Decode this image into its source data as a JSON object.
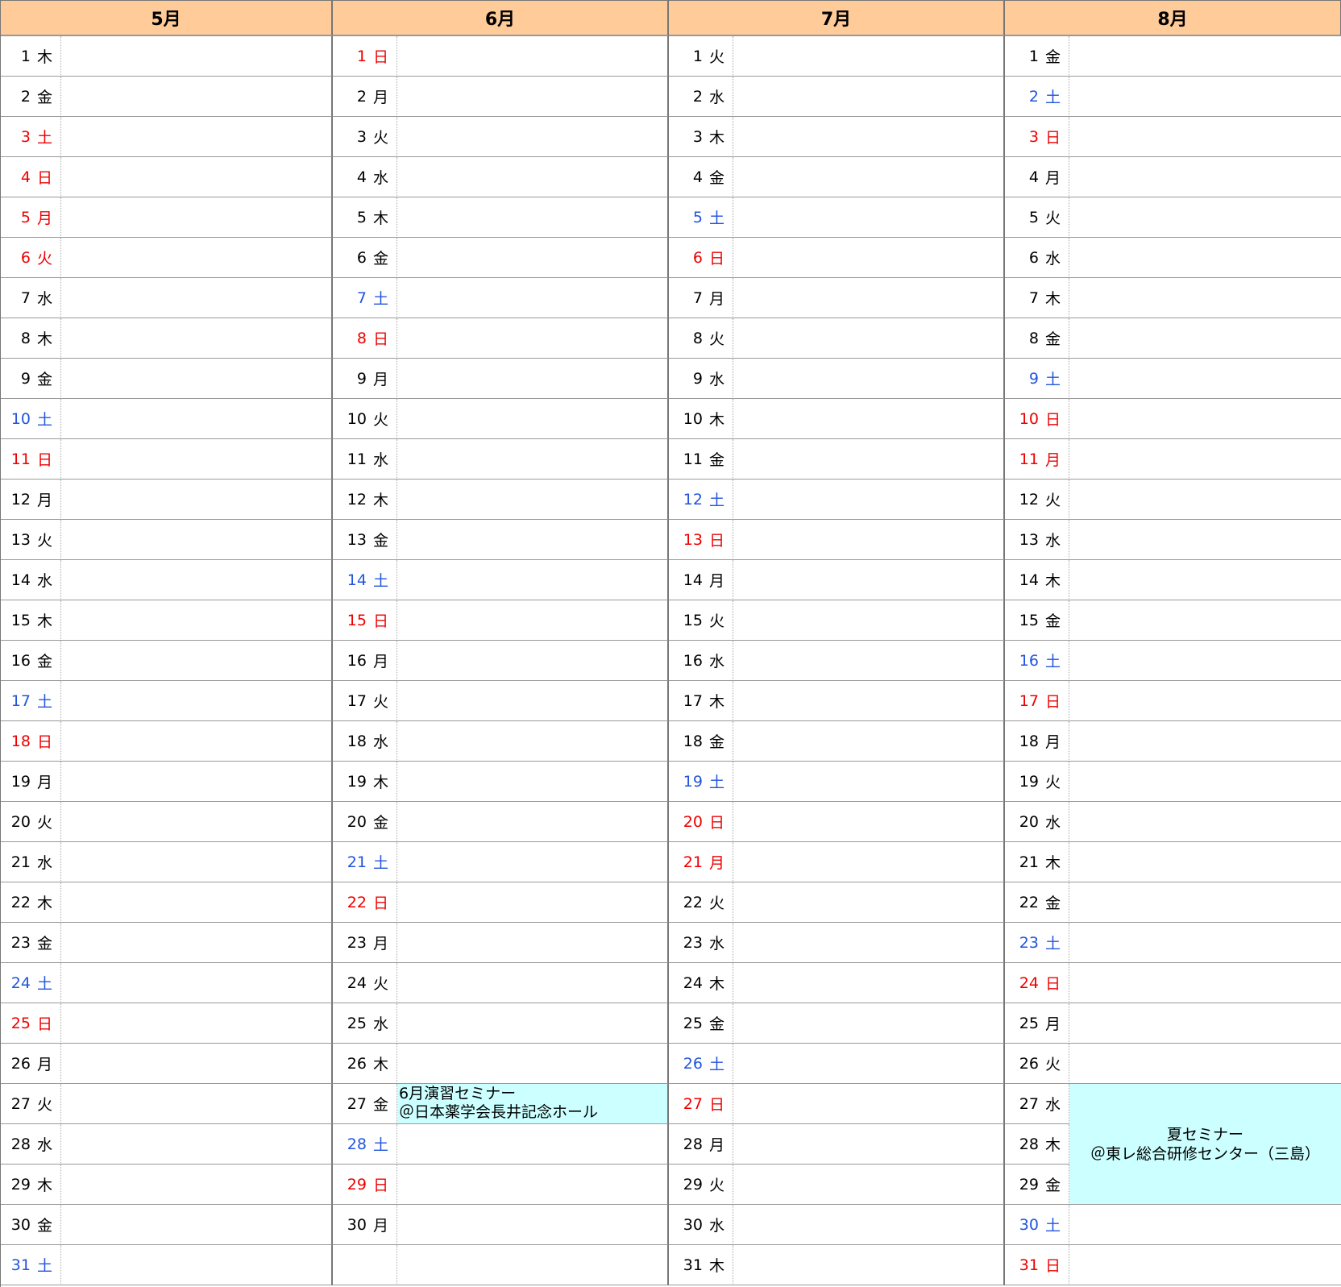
{
  "months": [
    {
      "title": "5月",
      "days": [
        {
          "d": "1",
          "w": "木",
          "t": ""
        },
        {
          "d": "2",
          "w": "金",
          "t": ""
        },
        {
          "d": "3",
          "w": "土",
          "t": "hol"
        },
        {
          "d": "4",
          "w": "日",
          "t": "hol"
        },
        {
          "d": "5",
          "w": "月",
          "t": "hol"
        },
        {
          "d": "6",
          "w": "火",
          "t": "hol"
        },
        {
          "d": "7",
          "w": "水",
          "t": ""
        },
        {
          "d": "8",
          "w": "木",
          "t": ""
        },
        {
          "d": "9",
          "w": "金",
          "t": ""
        },
        {
          "d": "10",
          "w": "土",
          "t": "sat"
        },
        {
          "d": "11",
          "w": "日",
          "t": "hol"
        },
        {
          "d": "12",
          "w": "月",
          "t": ""
        },
        {
          "d": "13",
          "w": "火",
          "t": ""
        },
        {
          "d": "14",
          "w": "水",
          "t": ""
        },
        {
          "d": "15",
          "w": "木",
          "t": ""
        },
        {
          "d": "16",
          "w": "金",
          "t": ""
        },
        {
          "d": "17",
          "w": "土",
          "t": "sat"
        },
        {
          "d": "18",
          "w": "日",
          "t": "hol"
        },
        {
          "d": "19",
          "w": "月",
          "t": ""
        },
        {
          "d": "20",
          "w": "火",
          "t": ""
        },
        {
          "d": "21",
          "w": "水",
          "t": ""
        },
        {
          "d": "22",
          "w": "木",
          "t": ""
        },
        {
          "d": "23",
          "w": "金",
          "t": ""
        },
        {
          "d": "24",
          "w": "土",
          "t": "sat"
        },
        {
          "d": "25",
          "w": "日",
          "t": "hol"
        },
        {
          "d": "26",
          "w": "月",
          "t": ""
        },
        {
          "d": "27",
          "w": "火",
          "t": ""
        },
        {
          "d": "28",
          "w": "水",
          "t": ""
        },
        {
          "d": "29",
          "w": "木",
          "t": ""
        },
        {
          "d": "30",
          "w": "金",
          "t": ""
        },
        {
          "d": "31",
          "w": "土",
          "t": "sat"
        }
      ]
    },
    {
      "title": "6月",
      "days": [
        {
          "d": "1",
          "w": "日",
          "t": "hol"
        },
        {
          "d": "2",
          "w": "月",
          "t": ""
        },
        {
          "d": "3",
          "w": "火",
          "t": ""
        },
        {
          "d": "4",
          "w": "水",
          "t": ""
        },
        {
          "d": "5",
          "w": "木",
          "t": ""
        },
        {
          "d": "6",
          "w": "金",
          "t": ""
        },
        {
          "d": "7",
          "w": "土",
          "t": "sat"
        },
        {
          "d": "8",
          "w": "日",
          "t": "hol"
        },
        {
          "d": "9",
          "w": "月",
          "t": ""
        },
        {
          "d": "10",
          "w": "火",
          "t": ""
        },
        {
          "d": "11",
          "w": "水",
          "t": ""
        },
        {
          "d": "12",
          "w": "木",
          "t": ""
        },
        {
          "d": "13",
          "w": "金",
          "t": ""
        },
        {
          "d": "14",
          "w": "土",
          "t": "sat"
        },
        {
          "d": "15",
          "w": "日",
          "t": "hol"
        },
        {
          "d": "16",
          "w": "月",
          "t": ""
        },
        {
          "d": "17",
          "w": "火",
          "t": ""
        },
        {
          "d": "18",
          "w": "水",
          "t": ""
        },
        {
          "d": "19",
          "w": "木",
          "t": ""
        },
        {
          "d": "20",
          "w": "金",
          "t": ""
        },
        {
          "d": "21",
          "w": "土",
          "t": "sat"
        },
        {
          "d": "22",
          "w": "日",
          "t": "hol"
        },
        {
          "d": "23",
          "w": "月",
          "t": ""
        },
        {
          "d": "24",
          "w": "火",
          "t": ""
        },
        {
          "d": "25",
          "w": "水",
          "t": ""
        },
        {
          "d": "26",
          "w": "木",
          "t": ""
        },
        {
          "d": "27",
          "w": "金",
          "t": ""
        },
        {
          "d": "28",
          "w": "土",
          "t": "sat"
        },
        {
          "d": "29",
          "w": "日",
          "t": "hol"
        },
        {
          "d": "30",
          "w": "月",
          "t": ""
        }
      ]
    },
    {
      "title": "7月",
      "days": [
        {
          "d": "1",
          "w": "火",
          "t": ""
        },
        {
          "d": "2",
          "w": "水",
          "t": ""
        },
        {
          "d": "3",
          "w": "木",
          "t": ""
        },
        {
          "d": "4",
          "w": "金",
          "t": ""
        },
        {
          "d": "5",
          "w": "土",
          "t": "sat"
        },
        {
          "d": "6",
          "w": "日",
          "t": "hol"
        },
        {
          "d": "7",
          "w": "月",
          "t": ""
        },
        {
          "d": "8",
          "w": "火",
          "t": ""
        },
        {
          "d": "9",
          "w": "水",
          "t": ""
        },
        {
          "d": "10",
          "w": "木",
          "t": ""
        },
        {
          "d": "11",
          "w": "金",
          "t": ""
        },
        {
          "d": "12",
          "w": "土",
          "t": "sat"
        },
        {
          "d": "13",
          "w": "日",
          "t": "hol"
        },
        {
          "d": "14",
          "w": "月",
          "t": ""
        },
        {
          "d": "15",
          "w": "火",
          "t": ""
        },
        {
          "d": "16",
          "w": "水",
          "t": ""
        },
        {
          "d": "17",
          "w": "木",
          "t": ""
        },
        {
          "d": "18",
          "w": "金",
          "t": ""
        },
        {
          "d": "19",
          "w": "土",
          "t": "sat"
        },
        {
          "d": "20",
          "w": "日",
          "t": "hol"
        },
        {
          "d": "21",
          "w": "月",
          "t": "hol"
        },
        {
          "d": "22",
          "w": "火",
          "t": ""
        },
        {
          "d": "23",
          "w": "水",
          "t": ""
        },
        {
          "d": "24",
          "w": "木",
          "t": ""
        },
        {
          "d": "25",
          "w": "金",
          "t": ""
        },
        {
          "d": "26",
          "w": "土",
          "t": "sat"
        },
        {
          "d": "27",
          "w": "日",
          "t": "hol"
        },
        {
          "d": "28",
          "w": "月",
          "t": ""
        },
        {
          "d": "29",
          "w": "火",
          "t": ""
        },
        {
          "d": "30",
          "w": "水",
          "t": ""
        },
        {
          "d": "31",
          "w": "木",
          "t": ""
        }
      ]
    },
    {
      "title": "8月",
      "days": [
        {
          "d": "1",
          "w": "金",
          "t": ""
        },
        {
          "d": "2",
          "w": "土",
          "t": "sat"
        },
        {
          "d": "3",
          "w": "日",
          "t": "hol"
        },
        {
          "d": "4",
          "w": "月",
          "t": ""
        },
        {
          "d": "5",
          "w": "火",
          "t": ""
        },
        {
          "d": "6",
          "w": "水",
          "t": ""
        },
        {
          "d": "7",
          "w": "木",
          "t": ""
        },
        {
          "d": "8",
          "w": "金",
          "t": ""
        },
        {
          "d": "9",
          "w": "土",
          "t": "sat"
        },
        {
          "d": "10",
          "w": "日",
          "t": "hol"
        },
        {
          "d": "11",
          "w": "月",
          "t": "hol"
        },
        {
          "d": "12",
          "w": "火",
          "t": ""
        },
        {
          "d": "13",
          "w": "水",
          "t": ""
        },
        {
          "d": "14",
          "w": "木",
          "t": ""
        },
        {
          "d": "15",
          "w": "金",
          "t": ""
        },
        {
          "d": "16",
          "w": "土",
          "t": "sat"
        },
        {
          "d": "17",
          "w": "日",
          "t": "hol"
        },
        {
          "d": "18",
          "w": "月",
          "t": ""
        },
        {
          "d": "19",
          "w": "火",
          "t": ""
        },
        {
          "d": "20",
          "w": "水",
          "t": ""
        },
        {
          "d": "21",
          "w": "木",
          "t": ""
        },
        {
          "d": "22",
          "w": "金",
          "t": ""
        },
        {
          "d": "23",
          "w": "土",
          "t": "sat"
        },
        {
          "d": "24",
          "w": "日",
          "t": "hol"
        },
        {
          "d": "25",
          "w": "月",
          "t": ""
        },
        {
          "d": "26",
          "w": "火",
          "t": ""
        },
        {
          "d": "27",
          "w": "水",
          "t": ""
        },
        {
          "d": "28",
          "w": "木",
          "t": ""
        },
        {
          "d": "29",
          "w": "金",
          "t": ""
        },
        {
          "d": "30",
          "w": "土",
          "t": "sat"
        },
        {
          "d": "31",
          "w": "日",
          "t": "hol"
        }
      ]
    }
  ],
  "events": [
    {
      "month": 1,
      "start": 27,
      "span": 1,
      "style": "ev1",
      "lines": [
        "6月演習セミナー",
        "＠日本薬学会長井記念ホール"
      ]
    },
    {
      "month": 3,
      "start": 27,
      "span": 3,
      "style": "ev2",
      "lines": [
        "夏セミナー",
        "＠東レ総合研修センター（三島）"
      ]
    }
  ],
  "colors": {
    "header_bg": "#ffcc99",
    "event_bg": "#ccffff",
    "saturday": "#2255dd",
    "holiday": "#ee0000"
  }
}
